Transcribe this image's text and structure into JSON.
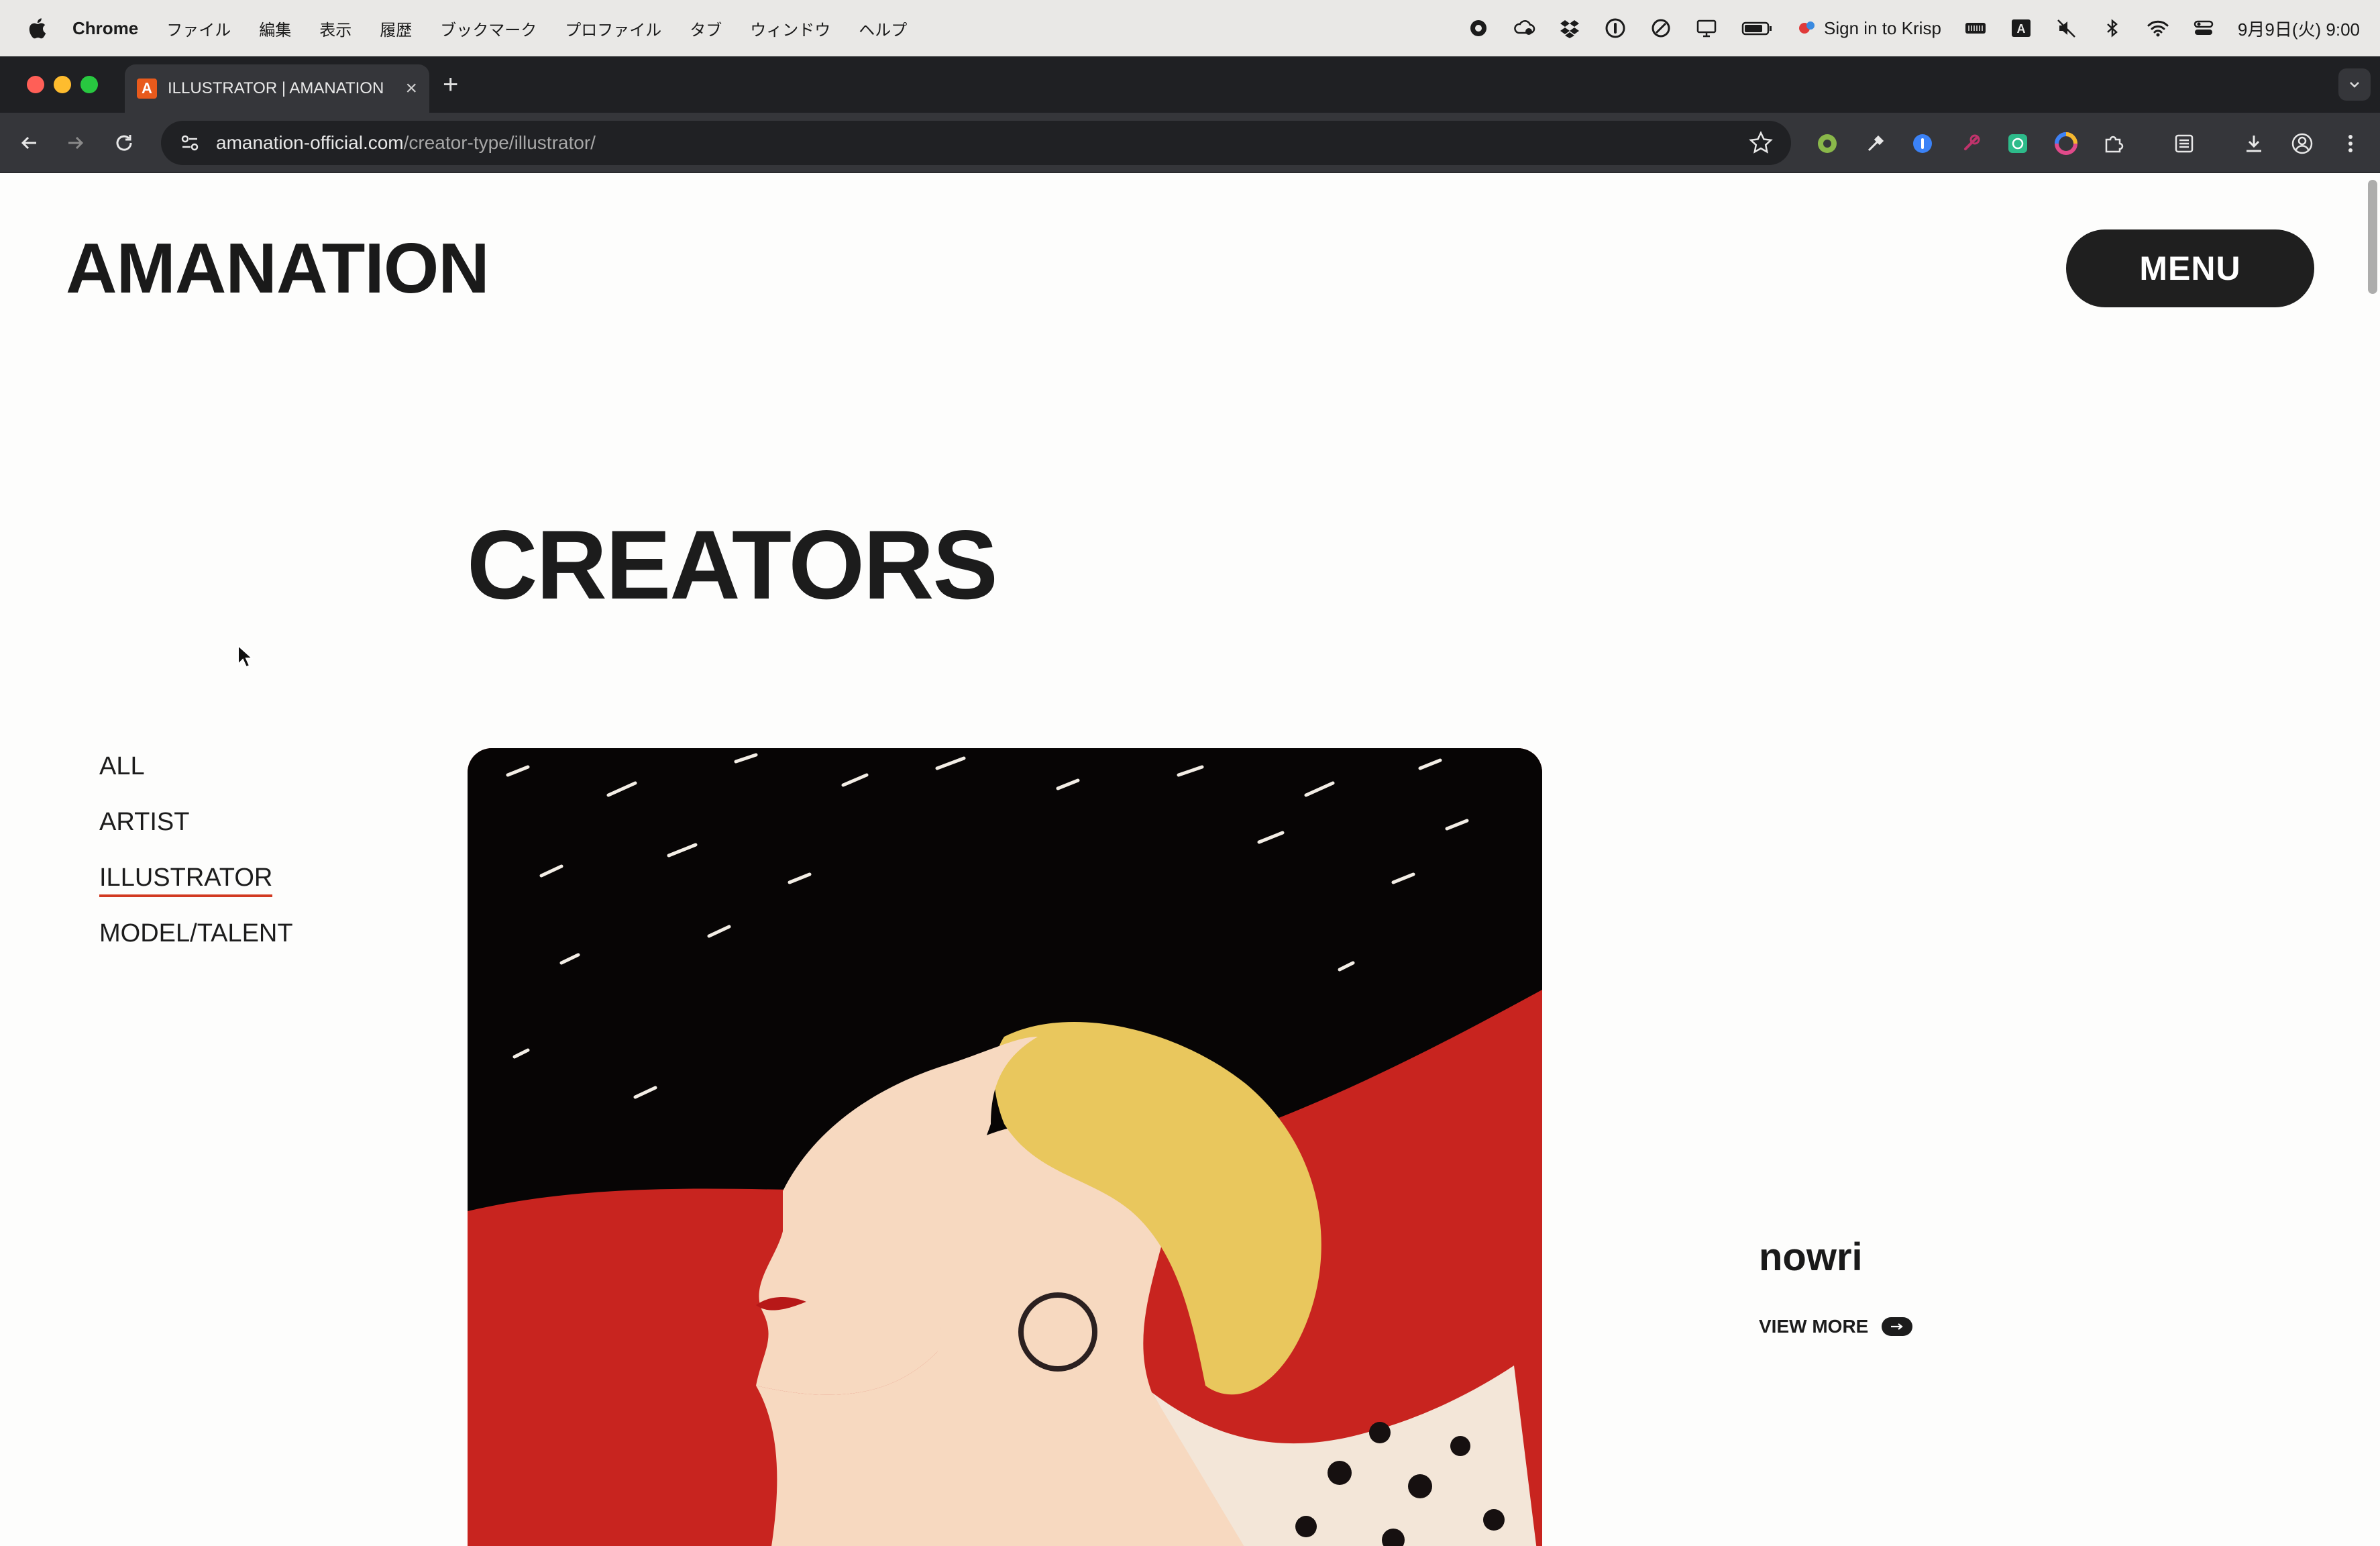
{
  "menubar": {
    "app_name": "Chrome",
    "items": [
      "ファイル",
      "編集",
      "表示",
      "履歴",
      "ブックマーク",
      "プロファイル",
      "タブ",
      "ウィンドウ",
      "ヘルプ"
    ],
    "krisp_label": "Sign in to Krisp",
    "datetime": "9月9日(火)  9:00",
    "status_icons": [
      "record-icon",
      "cloud-icon",
      "dropbox-icon",
      "onepassword-icon",
      "circle-icon",
      "display-icon",
      "battery-icon",
      "krisp-icon",
      "keyboard-icon",
      "input-source-icon",
      "mute-icon",
      "bluetooth-icon",
      "wifi-icon",
      "control-center-icon"
    ]
  },
  "browser": {
    "tab_title": "ILLUSTRATOR | AMANATION",
    "tab_favicon": "A",
    "url_domain": "amanation-official.com",
    "url_path": "/creator-type/illustrator/",
    "traffic_colors": [
      "#ff5f57",
      "#febc2e",
      "#28c840"
    ]
  },
  "site": {
    "logo": "AMANATION",
    "menu_label": "MENU",
    "page_title": "CREATORS",
    "filters": [
      "ALL",
      "ARTIST",
      "ILLUSTRATOR",
      "MODEL/TALENT"
    ],
    "active_filter": "ILLUSTRATOR",
    "accent_color": "#d23a22",
    "creator": {
      "name": "nowri",
      "view_more": "VIEW MORE"
    }
  }
}
